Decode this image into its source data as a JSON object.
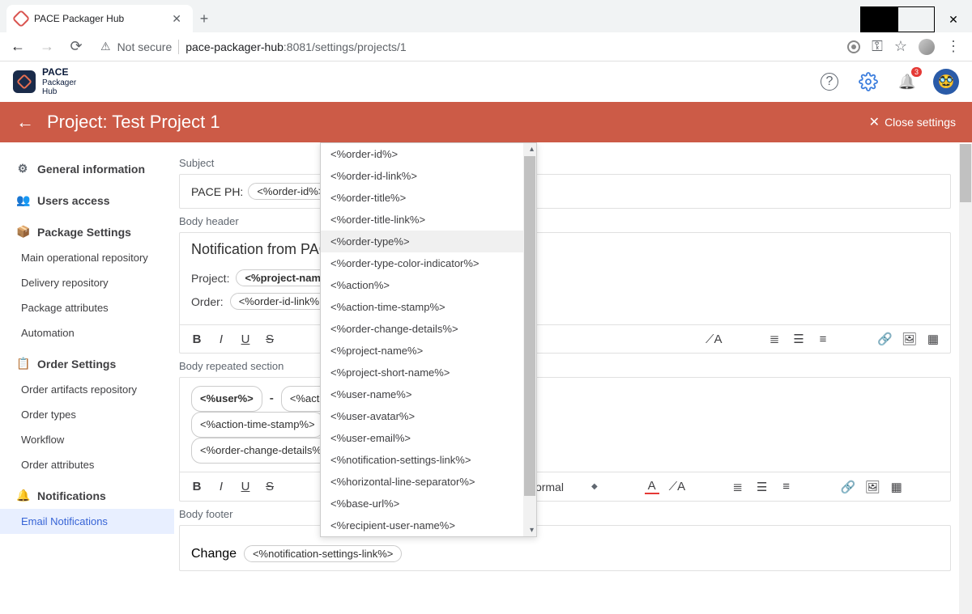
{
  "browser": {
    "tab_title": "PACE Packager Hub",
    "not_secure": "Not secure",
    "host": "pace-packager-hub",
    "port_path": ":8081/settings/projects/1"
  },
  "app": {
    "logo1": "PACE",
    "logo2": "Packager",
    "logo3": "Hub",
    "badge": "3"
  },
  "pagebar": {
    "title": "Project: Test Project 1",
    "close": "Close settings"
  },
  "sidebar": {
    "general": "General information",
    "users": "Users access",
    "pkg_settings": "Package Settings",
    "main_repo": "Main operational repository",
    "delivery_repo": "Delivery repository",
    "pkg_attr": "Package attributes",
    "automation": "Automation",
    "order_settings": "Order Settings",
    "order_artifacts": "Order artifacts repository",
    "order_types": "Order types",
    "workflow": "Workflow",
    "order_attr": "Order attributes",
    "notifications": "Notifications",
    "email_notif": "Email Notifications"
  },
  "sections": {
    "subject": "Subject",
    "body_header": "Body header",
    "body_repeated": "Body repeated section",
    "body_footer": "Body footer"
  },
  "subject": {
    "prefix": "PACE PH:",
    "tag1": "<%order-id%>",
    "dash": "-"
  },
  "body_header": {
    "title": "Notification from PAC",
    "project_label": "Project:",
    "project_tag": "<%project-name",
    "order_label": "Order:",
    "order_tag": "<%order-id-link%"
  },
  "body_repeated": {
    "user_tag": "<%user%>",
    "dash1": "-",
    "action_tag": "<%action%",
    "ts_tag": "<%action-time-stamp%>",
    "dash2": "-",
    "ocd_tag": "<%order-change-details%>",
    "typed": "<%"
  },
  "body_footer": {
    "change": "Change",
    "nsl_tag": "<%notification-settings-link%>"
  },
  "toolbar": {
    "normal": "Normal"
  },
  "dd": {
    "items": [
      "<%order-id%>",
      "<%order-id-link%>",
      "<%order-title%>",
      "<%order-title-link%>",
      "<%order-type%>",
      "<%order-type-color-indicator%>",
      "<%action%>",
      "<%action-time-stamp%>",
      "<%order-change-details%>",
      "<%project-name%>",
      "<%project-short-name%>",
      "<%user-name%>",
      "<%user-avatar%>",
      "<%user-email%>",
      "<%notification-settings-link%>",
      "<%horizontal-line-separator%>",
      "<%base-url%>",
      "<%recipient-user-name%>"
    ],
    "hover_index": 4
  }
}
